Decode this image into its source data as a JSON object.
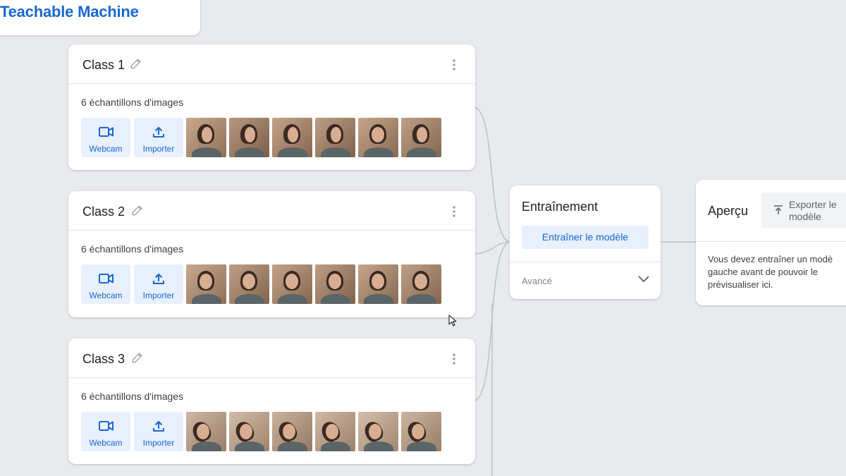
{
  "app": {
    "title": "Teachable Machine"
  },
  "classes": [
    {
      "name": "Class 1",
      "samples_label": "6 échantillons d'images",
      "webcam_label": "Webcam",
      "import_label": "Importer",
      "thumb_count": 6
    },
    {
      "name": "Class 2",
      "samples_label": "6 échantillons d'images",
      "webcam_label": "Webcam",
      "import_label": "Importer",
      "thumb_count": 6
    },
    {
      "name": "Class 3",
      "samples_label": "6 échantillons d'images",
      "webcam_label": "Webcam",
      "import_label": "Importer",
      "thumb_count": 6
    }
  ],
  "training": {
    "title": "Entraînement",
    "train_button": "Entraîner le modèle",
    "advanced_label": "Avancé"
  },
  "preview": {
    "title": "Aperçu",
    "export_button_line1": "Exporter le",
    "export_button_line2": "modèle",
    "message_line1": "Vous devez entraîner un modè",
    "message_line2": "gauche avant de pouvoir le",
    "message_line3": "prévisualiser ici."
  },
  "icons": {
    "webcam": "videocam-icon",
    "import": "upload-icon",
    "edit": "pencil-icon",
    "more": "more-vert-icon",
    "expand": "chevron-down-icon",
    "export": "export-upload-icon"
  },
  "colors": {
    "background": "#e8eaed",
    "accent": "#1967d2",
    "accent_light": "#e8f0fe",
    "card": "#ffffff"
  }
}
